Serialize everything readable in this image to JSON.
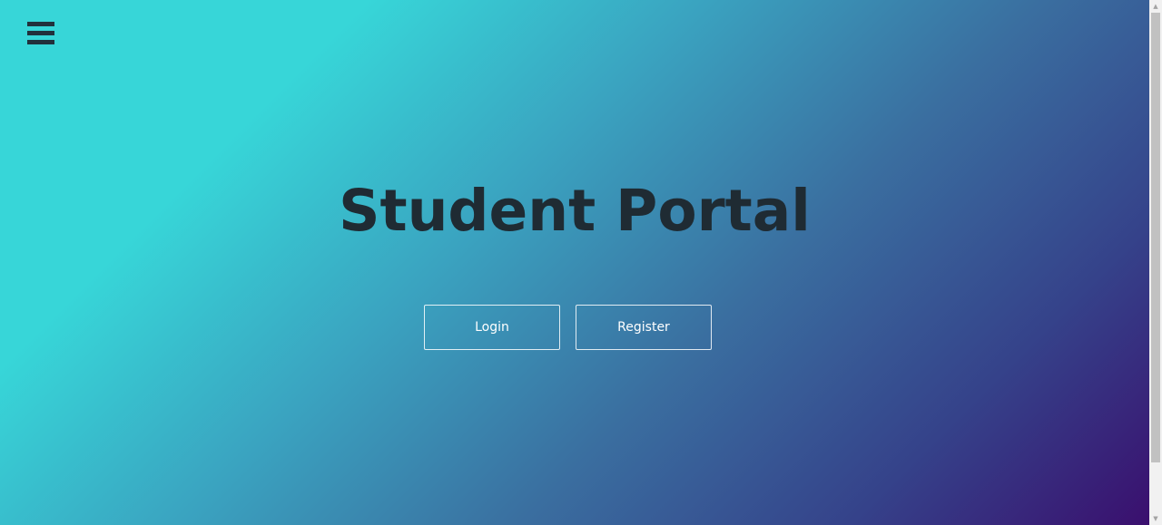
{
  "header": {
    "menu_icon": "hamburger-menu-icon"
  },
  "hero": {
    "title": "Student Portal",
    "login_label": "Login",
    "register_label": "Register"
  },
  "colors": {
    "gradient_start": "#37d6d8",
    "gradient_end": "#3a0f6e",
    "title_color": "#1f2b33",
    "button_text": "#ffffff"
  },
  "scrollbar": {
    "up_icon": "scroll-up-arrow-icon",
    "down_icon": "scroll-down-arrow-icon"
  }
}
